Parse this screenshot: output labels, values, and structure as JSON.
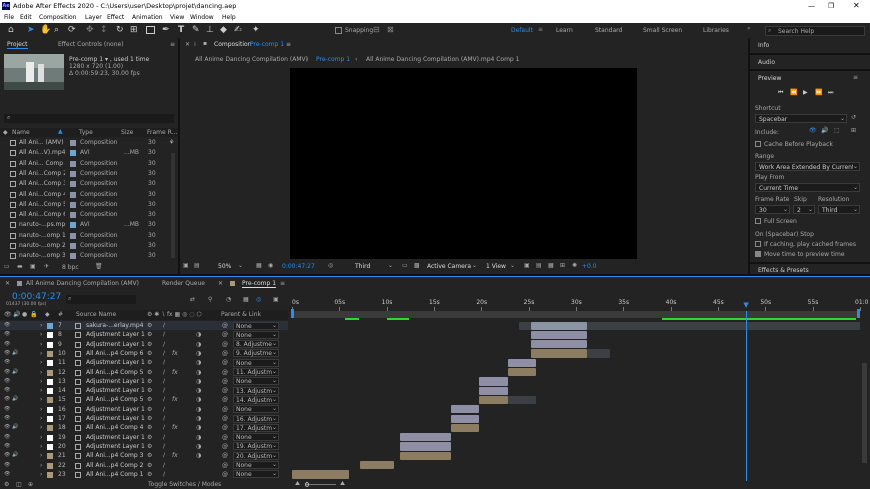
{
  "window": {
    "title": "Adobe After Effects 2020 - C:\\Users\\user\\Desktop\\projet\\dancing.aep",
    "controls": [
      "—",
      "❐",
      "✕"
    ]
  },
  "menu": [
    "File",
    "Edit",
    "Composition",
    "Layer",
    "Effect",
    "Animation",
    "View",
    "Window",
    "Help"
  ],
  "toolbar": {
    "snapping": "Snapping",
    "workspaces": [
      "Default",
      "Learn",
      "Standard",
      "Small Screen",
      "Libraries"
    ],
    "search_placeholder": "Search Help"
  },
  "project": {
    "tab_project": "Project",
    "tab_effects": "Effect Controls (none)",
    "selected_name": "Pre-comp 1 ▾ , used 1 time",
    "selected_dims": "1280 x 720  (1.00)",
    "selected_duration": "Δ 0:00:59:23, 30.00 fps",
    "search_placeholder": "⌕",
    "headers": [
      "Name",
      "Type",
      "Size",
      "Frame R..."
    ],
    "items": [
      {
        "name": "All Ani... (AMV)",
        "type": "Composition",
        "size": "",
        "fps": "30",
        "color": "#8b93a8"
      },
      {
        "name": "All Ani...V).mp4",
        "type": "AVI",
        "size": "...MB",
        "fps": "30",
        "color": "#6da6cf"
      },
      {
        "name": "All Ani... Comp 1",
        "type": "Composition",
        "size": "",
        "fps": "30",
        "color": "#8b93a8"
      },
      {
        "name": "All Ani...Comp 2",
        "type": "Composition",
        "size": "",
        "fps": "30",
        "color": "#8b93a8"
      },
      {
        "name": "All Ani...Comp 3",
        "type": "Composition",
        "size": "",
        "fps": "30",
        "color": "#8b93a8"
      },
      {
        "name": "All Ani...Comp 4",
        "type": "Composition",
        "size": "",
        "fps": "30",
        "color": "#8b93a8"
      },
      {
        "name": "All Ani...Comp 5",
        "type": "Composition",
        "size": "",
        "fps": "30",
        "color": "#8b93a8"
      },
      {
        "name": "All Ani...Comp 6",
        "type": "Composition",
        "size": "",
        "fps": "30",
        "color": "#8b93a8"
      },
      {
        "name": "naruto-...ps.mp4",
        "type": "AVI",
        "size": "...MB",
        "fps": "30",
        "color": "#6da6cf"
      },
      {
        "name": "naruto-...omp 1",
        "type": "Composition",
        "size": "",
        "fps": "30",
        "color": "#8b93a8"
      },
      {
        "name": "naruto-...omp 2",
        "type": "Composition",
        "size": "",
        "fps": "30",
        "color": "#8b93a8"
      },
      {
        "name": "naruto-...omp 3",
        "type": "Composition",
        "size": "",
        "fps": "30",
        "color": "#8b93a8"
      }
    ],
    "bpc": "8 bpc"
  },
  "composition": {
    "panel_title": "Composition",
    "panel_name": "Pre-comp 1",
    "tabs": [
      "All Anime Dancing Compilation (AMV)",
      "Pre-comp 1",
      "All Anime Dancing Compilation (AMV).mp4 Comp 1"
    ],
    "footer": {
      "zoom": "50%",
      "timecode": "0:00:47:27",
      "resolution": "Third",
      "camera": "Active Camera",
      "view": "1 View",
      "exposure": "+0.0"
    }
  },
  "right": {
    "info": "Info",
    "audio": "Audio",
    "preview": "Preview",
    "shortcut_label": "Shortcut",
    "shortcut": "Spacebar",
    "include_label": "Include:",
    "cache_before": "Cache Before Playback",
    "range_label": "Range",
    "range": "Work Area Extended By Current ...",
    "play_from_label": "Play From",
    "play_from": "Current Time",
    "frame_rate_label": "Frame Rate",
    "skip_label": "Skip",
    "resolution_label": "Resolution",
    "frame_rate": "30",
    "skip": "2",
    "resolution": "Third",
    "full_screen": "Full Screen",
    "on_stop": "On (Spacebar) Stop",
    "if_caching": "If caching, play cached frames",
    "move_time": "Move time to preview time",
    "effects": "Effects & Presets"
  },
  "timeline": {
    "tabs": [
      "All Anime Dancing Compilation (AMV)",
      "Render Queue",
      "Pre-comp 1"
    ],
    "timecode": "0:00:47:27",
    "fps_sub": "01437 (30.00 fps)",
    "search_placeholder": "⌕",
    "col_hash": "#",
    "col_source": "Source Name",
    "col_parent": "Parent & Link",
    "ruler": [
      "0s",
      "05s",
      "10s",
      "15s",
      "20s",
      "25s",
      "30s",
      "35s",
      "40s",
      "45s",
      "50s",
      "55s",
      "01:0"
    ],
    "toggle_label": "Toggle Switches / Modes",
    "layers": [
      {
        "num": "7",
        "name": "sakura-...erlay.mp4",
        "parent": "None",
        "label": "#6da6cf",
        "sel": true,
        "fx": false,
        "start": 0.42,
        "end": 0.52,
        "dim_start": 0.4,
        "dim_end": 1.0,
        "color": "#8b94a3"
      },
      {
        "num": "8",
        "name": "Adjustment Layer 1",
        "parent": "None",
        "label": "#ffffff",
        "fx": false,
        "start": 0.42,
        "end": 0.52,
        "dim_start": 0,
        "dim_end": 0,
        "color": "#8e8ea4"
      },
      {
        "num": "9",
        "name": "Adjustment Layer 1",
        "parent": "8. Adjustme",
        "label": "#ffffff",
        "fx": false,
        "start": 0.42,
        "end": 0.52,
        "dim_start": 0,
        "dim_end": 0,
        "color": "#8e8ea4"
      },
      {
        "num": "10",
        "name": "All Ani...p4 Comp 6",
        "parent": "9. Adjustme",
        "label": "#a89a7a",
        "fx": true,
        "start": 0.42,
        "end": 0.52,
        "dim_start": 0.52,
        "dim_end": 0.56,
        "color": "#8c7d62"
      },
      {
        "num": "11",
        "name": "Adjustment Layer 1",
        "parent": "None",
        "label": "#ffffff",
        "fx": false,
        "start": 0.38,
        "end": 0.43,
        "dim_start": 0,
        "dim_end": 0,
        "color": "#8e8ea4"
      },
      {
        "num": "12",
        "name": "All Ani...p4 Comp 5",
        "parent": "11. Adjustme",
        "label": "#a89a7a",
        "fx": true,
        "start": 0.38,
        "end": 0.43,
        "dim_start": 0,
        "dim_end": 0,
        "color": "#8c7d62"
      },
      {
        "num": "13",
        "name": "Adjustment Layer 1",
        "parent": "None",
        "label": "#ffffff",
        "fx": false,
        "start": 0.33,
        "end": 0.38,
        "dim_start": 0,
        "dim_end": 0,
        "color": "#8e8ea4"
      },
      {
        "num": "14",
        "name": "Adjustment Layer 1",
        "parent": "13. Adjustme",
        "label": "#ffffff",
        "fx": false,
        "start": 0.33,
        "end": 0.38,
        "dim_start": 0,
        "dim_end": 0,
        "color": "#8e8ea4"
      },
      {
        "num": "15",
        "name": "All Ani...p4 Comp 5",
        "parent": "14. Adjustme",
        "label": "#a89a7a",
        "fx": true,
        "start": 0.33,
        "end": 0.38,
        "dim_start": 0.38,
        "dim_end": 0.43,
        "color": "#8c7d62"
      },
      {
        "num": "16",
        "name": "Adjustment Layer 1",
        "parent": "None",
        "label": "#ffffff",
        "fx": false,
        "start": 0.28,
        "end": 0.33,
        "dim_start": 0,
        "dim_end": 0,
        "color": "#8e8ea4"
      },
      {
        "num": "17",
        "name": "Adjustment Layer 1",
        "parent": "16. Adjustme",
        "label": "#ffffff",
        "fx": false,
        "start": 0.28,
        "end": 0.33,
        "dim_start": 0,
        "dim_end": 0,
        "color": "#8e8ea4"
      },
      {
        "num": "18",
        "name": "All Ani...p4 Comp 4",
        "parent": "17. Adjustme",
        "label": "#a89a7a",
        "fx": true,
        "start": 0.28,
        "end": 0.33,
        "dim_start": 0,
        "dim_end": 0,
        "color": "#8c7d62"
      },
      {
        "num": "19",
        "name": "Adjustment Layer 1",
        "parent": "None",
        "label": "#ffffff",
        "fx": false,
        "start": 0.19,
        "end": 0.28,
        "dim_start": 0,
        "dim_end": 0,
        "color": "#8e8ea4"
      },
      {
        "num": "20",
        "name": "Adjustment Layer 1",
        "parent": "19. Adjustme",
        "label": "#ffffff",
        "fx": false,
        "start": 0.19,
        "end": 0.28,
        "dim_start": 0,
        "dim_end": 0,
        "color": "#8e8ea4"
      },
      {
        "num": "21",
        "name": "All Ani...p4 Comp 3",
        "parent": "20. Adjustme",
        "label": "#a89a7a",
        "fx": true,
        "start": 0.19,
        "end": 0.28,
        "dim_start": 0,
        "dim_end": 0,
        "color": "#8c7d62"
      },
      {
        "num": "22",
        "name": "All Ani...p4 Comp 2",
        "parent": "None",
        "label": "#a89a7a",
        "fx": false,
        "start": 0.12,
        "end": 0.18,
        "dim_start": 0,
        "dim_end": 0,
        "color": "#8c7d62"
      },
      {
        "num": "23",
        "name": "All Ani...p4 Comp 1",
        "parent": "None",
        "label": "#a89a7a",
        "fx": false,
        "start": 0.0,
        "end": 0.1,
        "dim_start": 0,
        "dim_end": 0,
        "color": "#8c7d62"
      }
    ],
    "playhead": 0.8,
    "work_area": [
      0.0,
      1.0
    ]
  }
}
